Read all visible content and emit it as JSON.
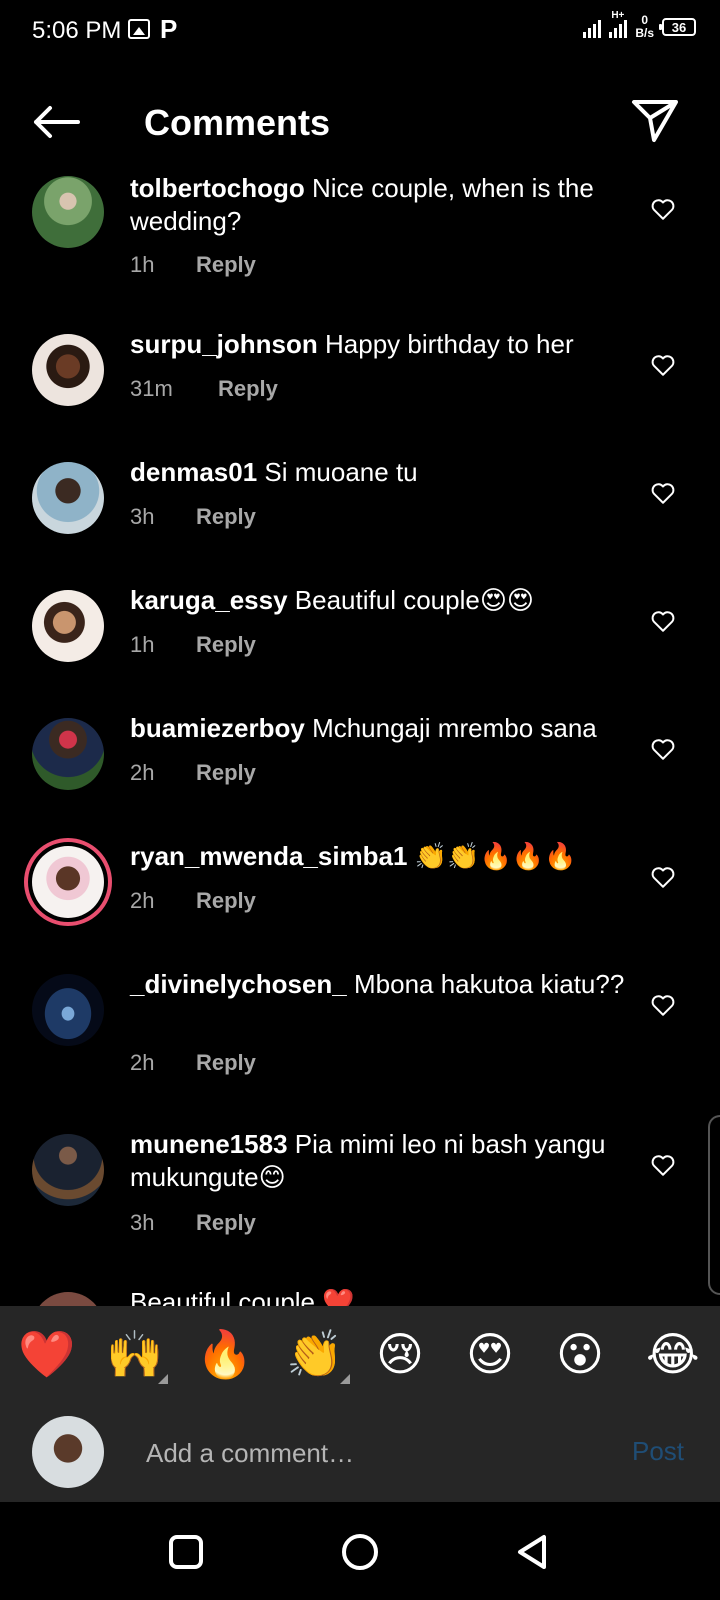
{
  "status": {
    "time": "5:06 PM",
    "net_top": "H+",
    "speed_value": "0",
    "speed_unit": "B/s",
    "battery": "36"
  },
  "header": {
    "title": "Comments"
  },
  "comments": [
    {
      "username": "tolbertochogo",
      "text": "Nice couple, when is the wedding?",
      "time": "1h",
      "reply": "Reply"
    },
    {
      "username": "surpu_johnson",
      "text": "Happy birthday to her",
      "time": "31m",
      "reply": "Reply"
    },
    {
      "username": "denmas01",
      "text": "Si muoane tu",
      "time": "3h",
      "reply": "Reply"
    },
    {
      "username": "karuga_essy",
      "text": "Beautiful couple😍😍",
      "time": "1h",
      "reply": "Reply"
    },
    {
      "username": "buamiezerboy",
      "text": "Mchungaji mrembo sana",
      "time": "2h",
      "reply": "Reply"
    },
    {
      "username": "ryan_mwenda_simba1",
      "text": "👏👏🔥🔥🔥",
      "time": "2h",
      "reply": "Reply"
    },
    {
      "username": "_divinelychosen_",
      "text": "Mbona hakutoa kiatu??",
      "time": "2h",
      "reply": "Reply"
    },
    {
      "username": "munene1583",
      "text": "Pia mimi leo ni bash yangu mukungute😊",
      "time": "3h",
      "reply": "Reply"
    }
  ],
  "partial_comment": "Beautiful couple ❤️",
  "emoji_bar": [
    "❤️",
    "🙌",
    "🔥",
    "👏",
    "😢",
    "😍",
    "😮",
    "😂"
  ],
  "comment_box": {
    "placeholder": "Add a comment…",
    "post_label": "Post"
  },
  "icons": {
    "back": "arrow-left-icon",
    "send": "paper-plane-icon",
    "like": "heart-outline-icon"
  },
  "colors": {
    "background": "#000000",
    "panel": "#262626",
    "meta_text": "#a8a8a8",
    "post_disabled": "#1f4d75",
    "story_ring": "#e94e6f"
  }
}
